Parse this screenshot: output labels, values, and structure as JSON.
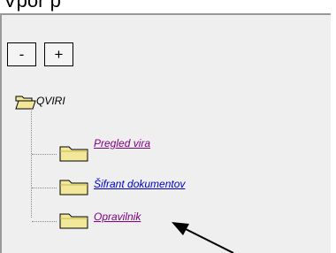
{
  "header": {
    "partial_text": "Vpor p"
  },
  "controls": {
    "collapse_label": "-",
    "expand_label": "+"
  },
  "tree": {
    "root_label": "QVIRI",
    "items": [
      {
        "label": "Pregled vira",
        "visited": true
      },
      {
        "label": "Šifrant dokumentov",
        "visited": false
      },
      {
        "label": "Opravilnik",
        "visited": true
      }
    ]
  },
  "colors": {
    "panel_bg": "#efefef",
    "visited_link": "#800080",
    "link": "#0000cc",
    "folder": "#f3e89a"
  },
  "icons": [
    "folder-open-icon",
    "folder-icon",
    "arrow-pointer-icon"
  ]
}
